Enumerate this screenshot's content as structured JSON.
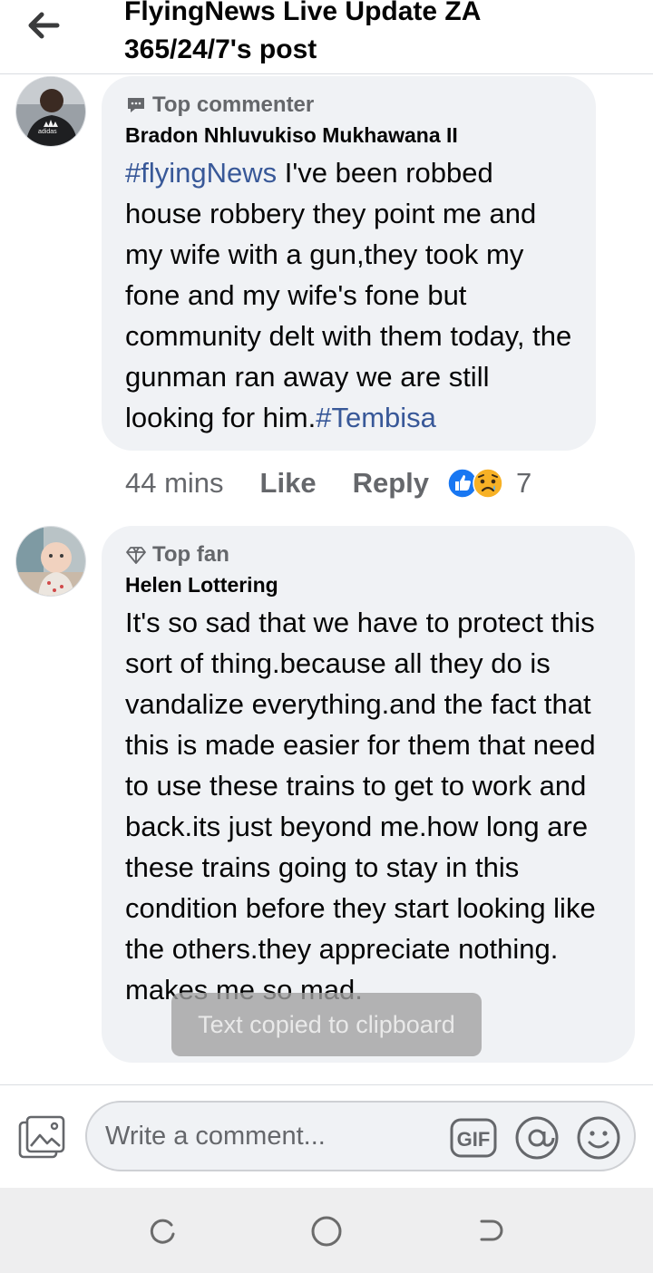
{
  "header": {
    "title_line1": "FlyingNews Live Update ZA",
    "title_line2": "365/24/7's post"
  },
  "comments": [
    {
      "badge": "Top commenter",
      "author": "Bradon Nhluvukiso Mukhawana II",
      "hashtag_start": "#flyingNews",
      "text": " I've been robbed house robbery they point me and my wife with a gun,they took my fone and my wife's fone but community delt with them today, the gunman ran away we are still looking for him.",
      "hashtag_end": "#Tembisa",
      "time": "44 mins",
      "like_label": "Like",
      "reply_label": "Reply",
      "reaction_count": "7",
      "avatar_text": "adidas"
    },
    {
      "badge": "Top fan",
      "author": "Helen Lottering",
      "text": "It's so sad that we have to protect this sort of thing.because all they do is vandalize everything.and the fact that this is made easier for them that need to use these trains to get to work and back.its just beyond me.how long are these trains going to stay in this condition before they start looking like the others.they appreciate nothing. makes me so mad."
    }
  ],
  "toast": "Text copied to clipboard",
  "composer": {
    "placeholder": "Write a comment...",
    "gif_label": "GIF"
  },
  "colors": {
    "hashtag": "#385898",
    "like_blue": "#1877f2",
    "bubble": "#f0f2f5"
  }
}
